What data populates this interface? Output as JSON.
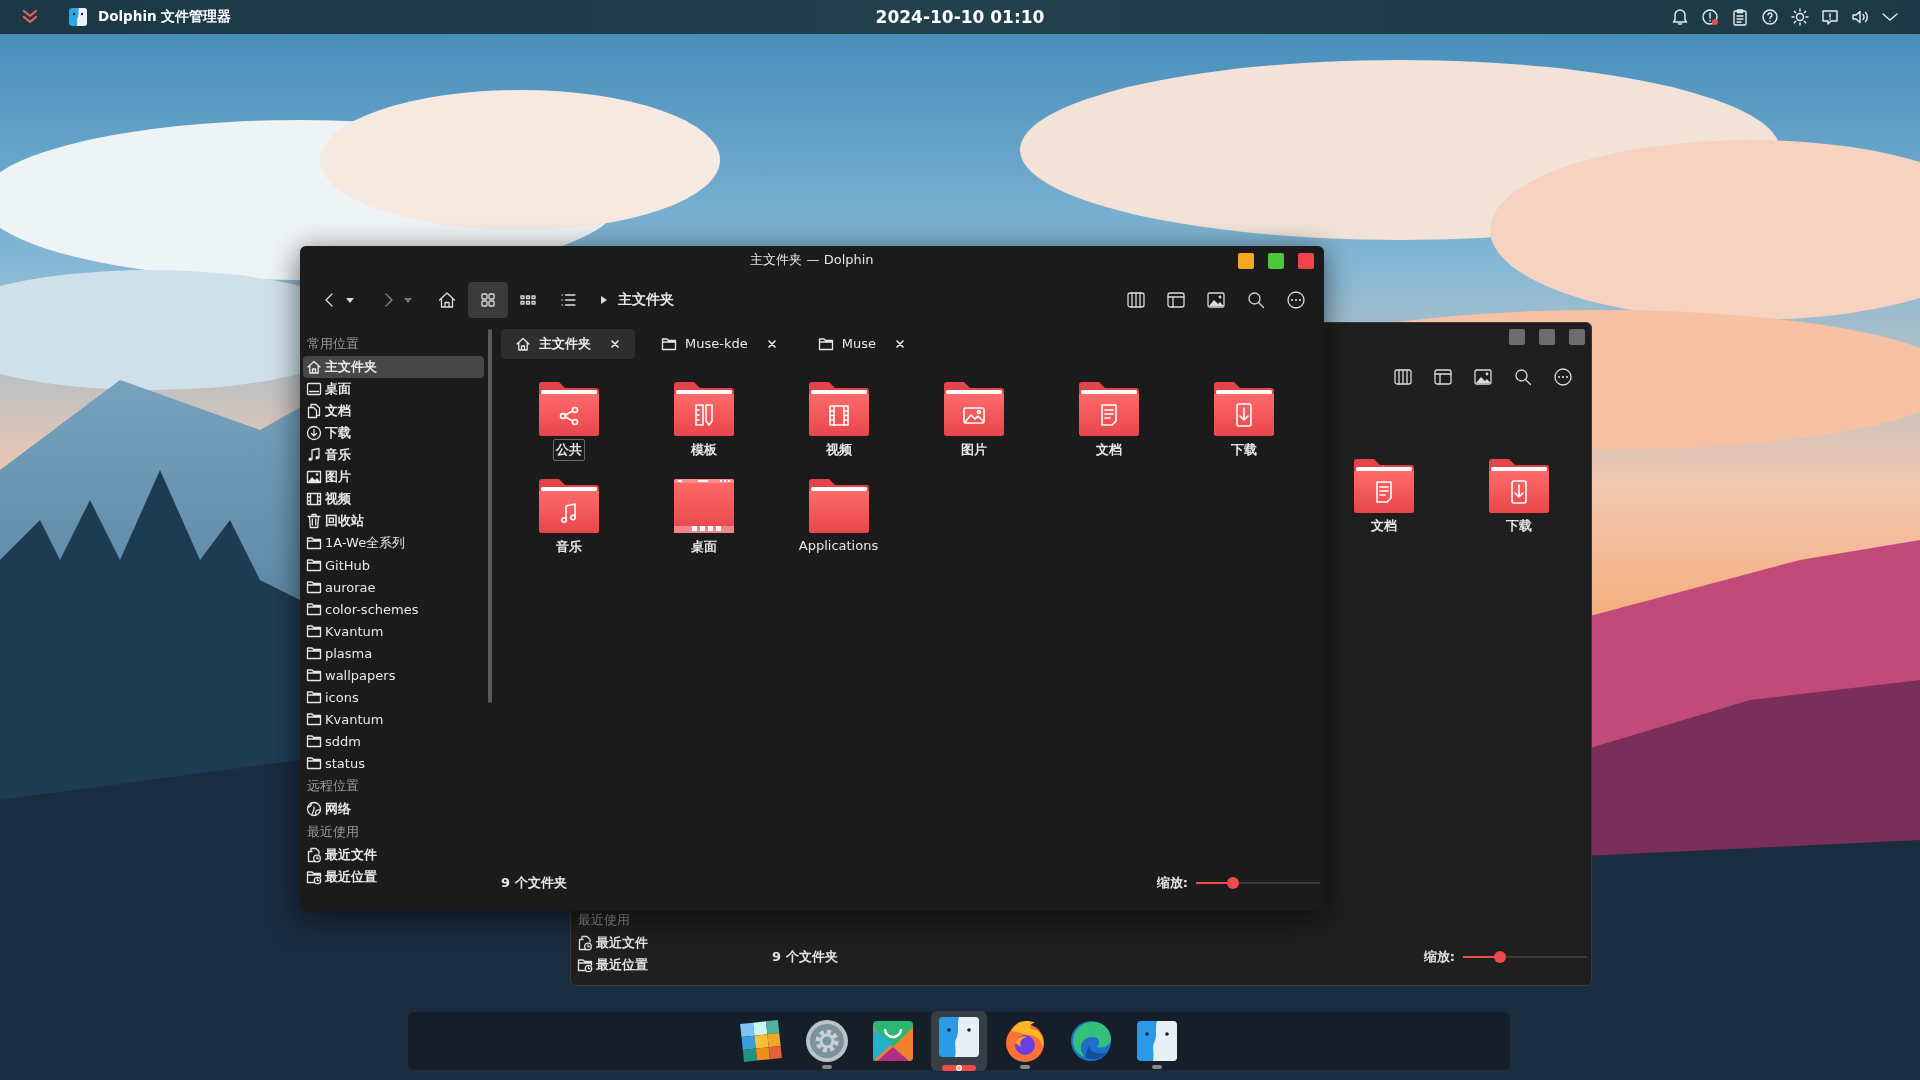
{
  "top_bar": {
    "app_title": "Dolphin 文件管理器",
    "clock": "2024-10-10 01:10"
  },
  "back_window": {
    "active": false,
    "recent_heading": "最近使用",
    "recent_items": [
      {
        "label": "最近文件",
        "kind": "recent-files"
      },
      {
        "label": "最近位置",
        "kind": "recent-locations"
      }
    ],
    "folders": [
      {
        "name": "文档",
        "kind": "documents"
      },
      {
        "name": "下载",
        "kind": "downloads"
      }
    ],
    "status": "9 个文件夹",
    "zoom_label": "缩放:",
    "zoom": {
      "level": 0.3
    }
  },
  "front_window": {
    "active": true,
    "title": "主文件夹 — Dolphin",
    "view_modes": [
      {
        "kind": "icons",
        "selected": true
      },
      {
        "kind": "compact",
        "selected": false
      },
      {
        "kind": "details",
        "selected": false
      }
    ],
    "breadcrumb": "主文件夹",
    "tabs": [
      {
        "label": "主文件夹",
        "kind": "home",
        "selected": true
      },
      {
        "label": "Muse-kde",
        "kind": "folder",
        "selected": false
      },
      {
        "label": "Muse",
        "kind": "folder",
        "selected": false
      }
    ],
    "sidebar": {
      "sections": [
        {
          "heading": "常用位置",
          "items": [
            {
              "label": "主文件夹",
              "kind": "home",
              "selected": true
            },
            {
              "label": "桌面",
              "kind": "desktop",
              "selected": false
            },
            {
              "label": "文档",
              "kind": "documents",
              "selected": false
            },
            {
              "label": "下载",
              "kind": "downloads",
              "selected": false
            },
            {
              "label": "音乐",
              "kind": "music",
              "selected": false
            },
            {
              "label": "图片",
              "kind": "pictures",
              "selected": false
            },
            {
              "label": "视频",
              "kind": "videos",
              "selected": false
            },
            {
              "label": "回收站",
              "kind": "trash",
              "selected": false
            },
            {
              "label": "1A-We全系列",
              "kind": "folder",
              "selected": false
            },
            {
              "label": "GitHub",
              "kind": "folder",
              "selected": false
            },
            {
              "label": "aurorae",
              "kind": "folder",
              "selected": false
            },
            {
              "label": "color-schemes",
              "kind": "folder",
              "selected": false
            },
            {
              "label": "Kvantum",
              "kind": "folder",
              "selected": false
            },
            {
              "label": "plasma",
              "kind": "folder",
              "selected": false
            },
            {
              "label": "wallpapers",
              "kind": "folder",
              "selected": false
            },
            {
              "label": "icons",
              "kind": "folder",
              "selected": false
            },
            {
              "label": "Kvantum",
              "kind": "folder",
              "selected": false
            },
            {
              "label": "sddm",
              "kind": "folder",
              "selected": false
            },
            {
              "label": "status",
              "kind": "folder",
              "selected": false
            }
          ]
        },
        {
          "heading": "远程位置",
          "items": [
            {
              "label": "网络",
              "kind": "network",
              "selected": false
            }
          ]
        },
        {
          "heading": "最近使用",
          "items": [
            {
              "label": "最近文件",
              "kind": "recent-files",
              "selected": false
            },
            {
              "label": "最近位置",
              "kind": "recent-locations",
              "selected": false
            }
          ]
        }
      ]
    },
    "folders": [
      {
        "name": "公共",
        "kind": "public",
        "focused": true
      },
      {
        "name": "模板",
        "kind": "templates",
        "focused": false
      },
      {
        "name": "视频",
        "kind": "videos",
        "focused": false
      },
      {
        "name": "图片",
        "kind": "pictures",
        "focused": false
      },
      {
        "name": "文档",
        "kind": "documents",
        "focused": false
      },
      {
        "name": "下载",
        "kind": "downloads",
        "focused": false
      },
      {
        "name": "音乐",
        "kind": "music",
        "focused": false
      },
      {
        "name": "桌面",
        "kind": "desktop",
        "focused": false
      },
      {
        "name": "Applications",
        "kind": "plain",
        "focused": false
      }
    ],
    "status": "9 个文件夹",
    "zoom_label": "缩放:",
    "zoom": {
      "level": 0.3
    }
  },
  "dock": {
    "items": [
      {
        "kind": "tiles",
        "running": false,
        "selected": false
      },
      {
        "kind": "gear",
        "running": true,
        "selected": false
      },
      {
        "kind": "bag",
        "running": false,
        "selected": false
      },
      {
        "kind": "face",
        "running": true,
        "selected": true
      },
      {
        "kind": "fox",
        "running": true,
        "selected": false
      },
      {
        "kind": "wave",
        "running": false,
        "selected": false
      },
      {
        "kind": "face",
        "running": true,
        "selected": false
      }
    ]
  }
}
